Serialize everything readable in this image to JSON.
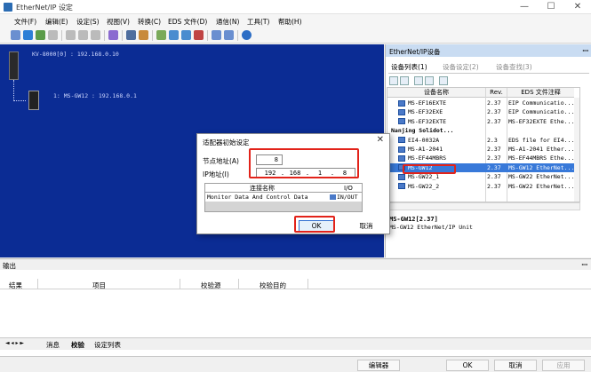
{
  "window": {
    "title": "EtherNet/IP 设定",
    "min": "—",
    "max": "☐",
    "close": "✕"
  },
  "menu": [
    "文件(F)",
    "编辑(E)",
    "设定(S)",
    "视图(V)",
    "转换(C)",
    "EDS 文件(D)",
    "通信(N)",
    "工具(T)",
    "帮助(H)"
  ],
  "canvas": {
    "plc_label": "KV-8000[0] : 192.168.0.10",
    "device_label": "1: MS-GW12 : 192.168.0.1"
  },
  "panel": {
    "title": "EtherNet/IP设备",
    "pin": "ꟷ",
    "tabs": [
      "设备列表(1)",
      "设备设定(2)",
      "设备查找(3)"
    ],
    "columns": [
      "设备名称",
      "Rev.",
      "EDS 文件注释"
    ],
    "rows": [
      {
        "name": "MS-EF16EXTE",
        "rev": "2.37",
        "note": "EIP Communicatio...",
        "type": "item"
      },
      {
        "name": "MS-EF32EXE",
        "rev": "2.37",
        "note": "EIP Communicatio...",
        "type": "item"
      },
      {
        "name": "MS-EF32EXTE",
        "rev": "2.37",
        "note": "MS-EF32EXTE Ethe...",
        "type": "item"
      },
      {
        "name": "Nanjing Solidot...",
        "rev": "",
        "note": "",
        "type": "group"
      },
      {
        "name": "EI4-0032A",
        "rev": "2.3",
        "note": "EDS file for EI4...",
        "type": "item"
      },
      {
        "name": "MS-A1-2041",
        "rev": "2.37",
        "note": "MS-A1-2041 Ether...",
        "type": "item"
      },
      {
        "name": "MS-EF44MBRS",
        "rev": "2.37",
        "note": "MS-EF44MBRS Ethe...",
        "type": "item"
      },
      {
        "name": "MS-GW12",
        "rev": "2.37",
        "note": "MS-GW12 EtherNet...",
        "type": "selected"
      },
      {
        "name": "MS-GW22_1",
        "rev": "2.37",
        "note": "MS-GW22 EtherNet...",
        "type": "item"
      },
      {
        "name": "MS-GW22_2",
        "rev": "2.37",
        "note": "MS-GW22 EtherNet...",
        "type": "item"
      }
    ],
    "detail_name": "MS-GW12[2.37]",
    "detail_desc": "MS-GW12 EtherNet/IP Unit"
  },
  "dialog": {
    "title": "适配器初始设定",
    "close": "✕",
    "node_label": "节点地址(A)",
    "node_value": "8",
    "ip_label": "IP地址(I)",
    "ip": [
      "192",
      "168",
      "1",
      "8"
    ],
    "conn_header": "连接名称",
    "io_header": "I/O",
    "conn_name": "Monitor Data And Control Data",
    "conn_io": "IN/OUT",
    "ok": "OK",
    "cancel": "取消"
  },
  "output": {
    "title": "输出",
    "pin": "ꟷ",
    "columns": [
      "结果",
      "项目",
      "校验源",
      "校验目的"
    ],
    "nav": "◄ ◂ ▸ ►",
    "tabs": [
      "消息",
      "校验",
      "设定列表"
    ]
  },
  "status": {
    "field": "编辑器",
    "ok": "OK",
    "cancel": "取消",
    "apply": "应用"
  },
  "colors": {
    "canvas": "#0b2c94",
    "selection": "#3879d9",
    "highlight": "#e2231a"
  }
}
